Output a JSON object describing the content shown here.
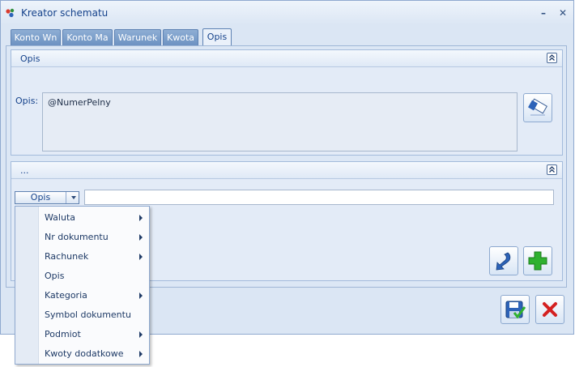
{
  "window": {
    "title": "Kreator schematu"
  },
  "titlebar_buttons": {
    "minimize": "–",
    "close": "✕"
  },
  "tabs": [
    {
      "label": "Konto Wn"
    },
    {
      "label": "Konto Ma"
    },
    {
      "label": "Warunek"
    },
    {
      "label": "Kwota"
    },
    {
      "label": "Opis"
    }
  ],
  "active_tab": "Opis",
  "opis_group": {
    "title": "Opis",
    "field_label": "Opis:",
    "field_value": "@NumerPelny"
  },
  "second_group": {
    "title": "..."
  },
  "combo": {
    "value": "Opis"
  },
  "text_input": {
    "value": ""
  },
  "menu_items": [
    {
      "label": "Waluta",
      "has_submenu": true
    },
    {
      "label": "Nr dokumentu",
      "has_submenu": true
    },
    {
      "label": "Rachunek",
      "has_submenu": true
    },
    {
      "label": "Opis",
      "has_submenu": false
    },
    {
      "label": "Kategoria",
      "has_submenu": true
    },
    {
      "label": "Symbol dokumentu",
      "has_submenu": false
    },
    {
      "label": "Podmiot",
      "has_submenu": true
    },
    {
      "label": "Kwoty dodatkowe",
      "has_submenu": true
    }
  ],
  "icons": {
    "app": "app-logo-icon",
    "edit": "eraser-edit-icon",
    "back": "return-arrow-icon",
    "add": "plus-add-icon",
    "save": "save-disk-icon",
    "cancel": "cancel-x-icon"
  },
  "colors": {
    "accent": "#15428b",
    "window_bg": "#dbe6f4",
    "tab_bg": "#6d92c2",
    "add_green": "#2fb12f",
    "cancel_red": "#d42020",
    "arrow_blue": "#2d63b8"
  }
}
